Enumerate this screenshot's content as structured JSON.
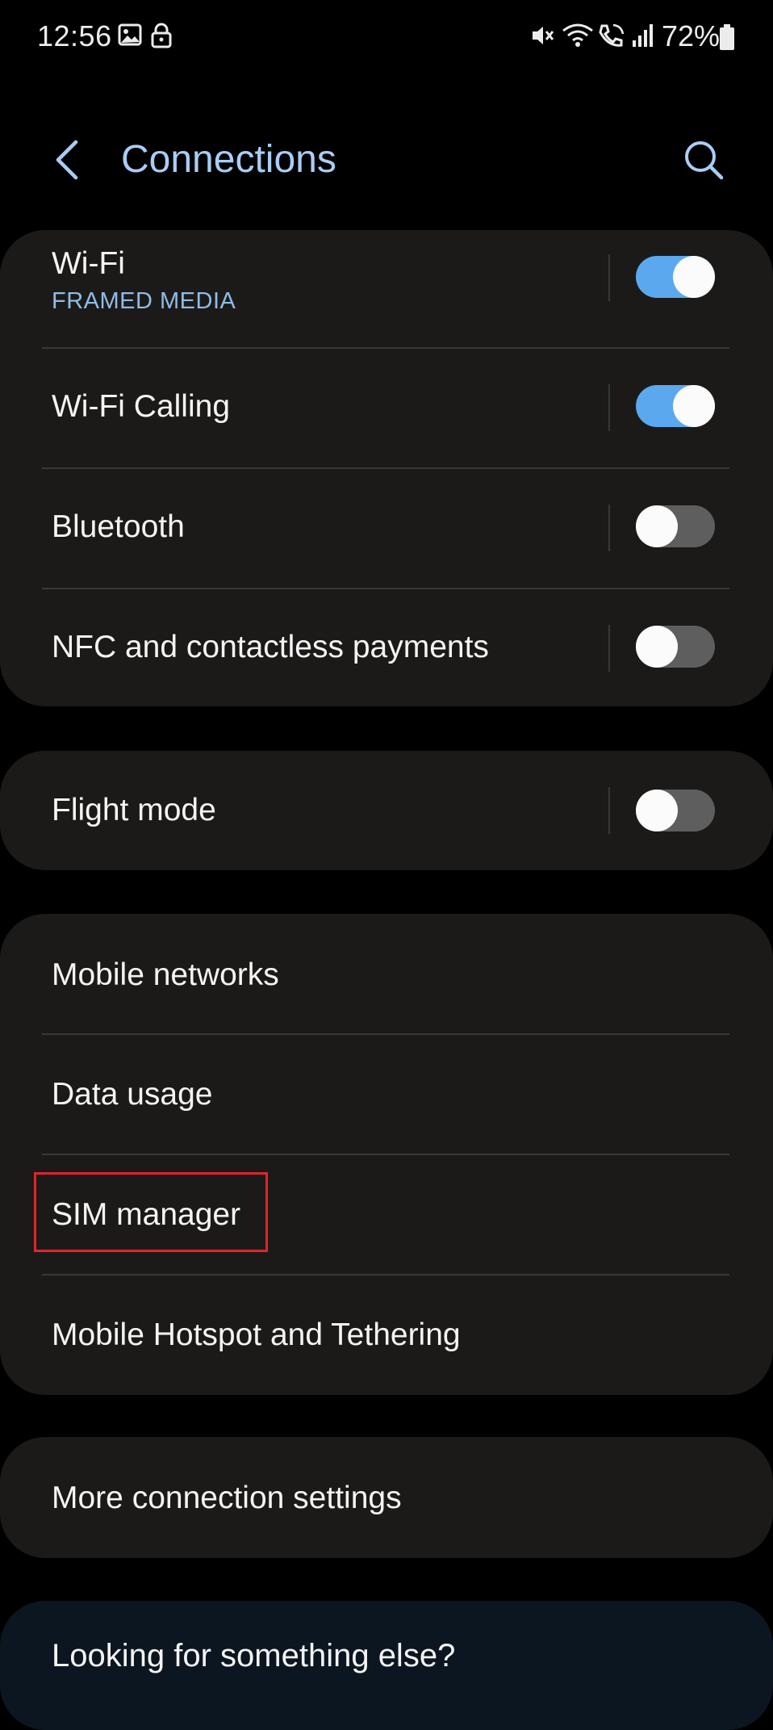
{
  "status_bar": {
    "time": "12:56",
    "battery": "72%",
    "left_icons": [
      "image-icon",
      "lock-icon"
    ],
    "right_icons": [
      "mute-icon",
      "wifi-icon",
      "wifi-calling-icon",
      "signal-icon",
      "battery-icon"
    ]
  },
  "header": {
    "title": "Connections",
    "back_icon": "chevron-left-icon",
    "search_icon": "search-icon"
  },
  "colors": {
    "title": "#a9cdf4",
    "toggle_on": "#5ba8ee",
    "toggle_off": "#5e5e5e",
    "card_bg": "#1c1a18",
    "highlight": "#e0252b"
  },
  "group_toggles": {
    "items": [
      {
        "label": "Wi-Fi",
        "sublabel": "FRAMED MEDIA",
        "on": true
      },
      {
        "label": "Wi-Fi Calling",
        "on": true
      },
      {
        "label": "Bluetooth",
        "on": false
      },
      {
        "label": "NFC and contactless payments",
        "on": false
      }
    ]
  },
  "group_flight": {
    "items": [
      {
        "label": "Flight mode",
        "on": false
      }
    ]
  },
  "group_mobile": {
    "items": [
      {
        "label": "Mobile networks"
      },
      {
        "label": "Data usage"
      },
      {
        "label": "SIM manager",
        "highlighted": true
      },
      {
        "label": "Mobile Hotspot and Tethering"
      }
    ]
  },
  "group_more": {
    "items": [
      {
        "label": "More connection settings"
      }
    ]
  },
  "footer": {
    "label": "Looking for something else?"
  }
}
